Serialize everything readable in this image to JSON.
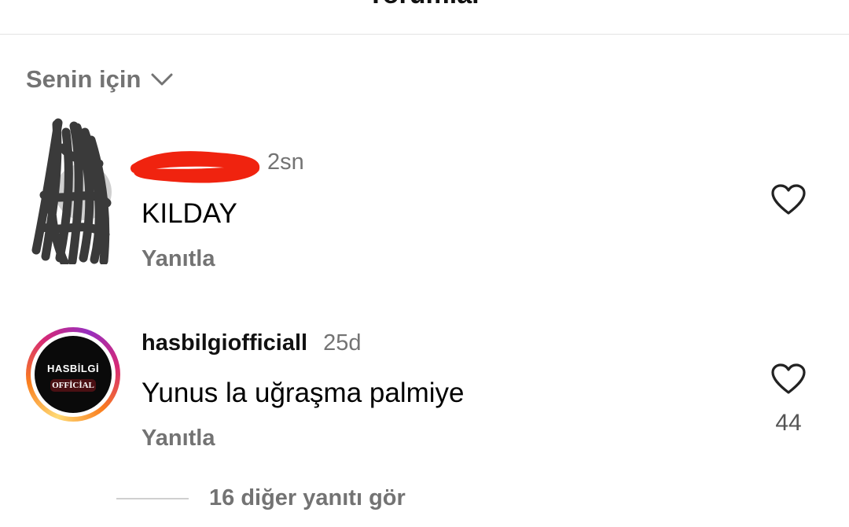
{
  "header": {
    "title": "Yorumlar"
  },
  "sort": {
    "label": "Senin için"
  },
  "comments": [
    {
      "username": "",
      "time": "2sn",
      "text": "KILDAY",
      "reply": "Yanıtla",
      "likes": ""
    },
    {
      "username": "hasbilgiofficiall",
      "time": "25d",
      "text": "Yunus la uğraşma palmiye",
      "reply": "Yanıtla",
      "likes": "44",
      "avatar_logo_top": "HASBİLGİ",
      "avatar_logo_bottom": "OFFİCİAL"
    }
  ],
  "more_replies": {
    "label": "16 diğer yanıtı gör"
  },
  "colors": {
    "secondary_text": "#737373",
    "scribble_red": "#f0230f",
    "scribble_dark": "#3a3a3a"
  },
  "icons": {
    "heart": "heart-outline-icon",
    "chevron": "chevron-down-icon"
  }
}
